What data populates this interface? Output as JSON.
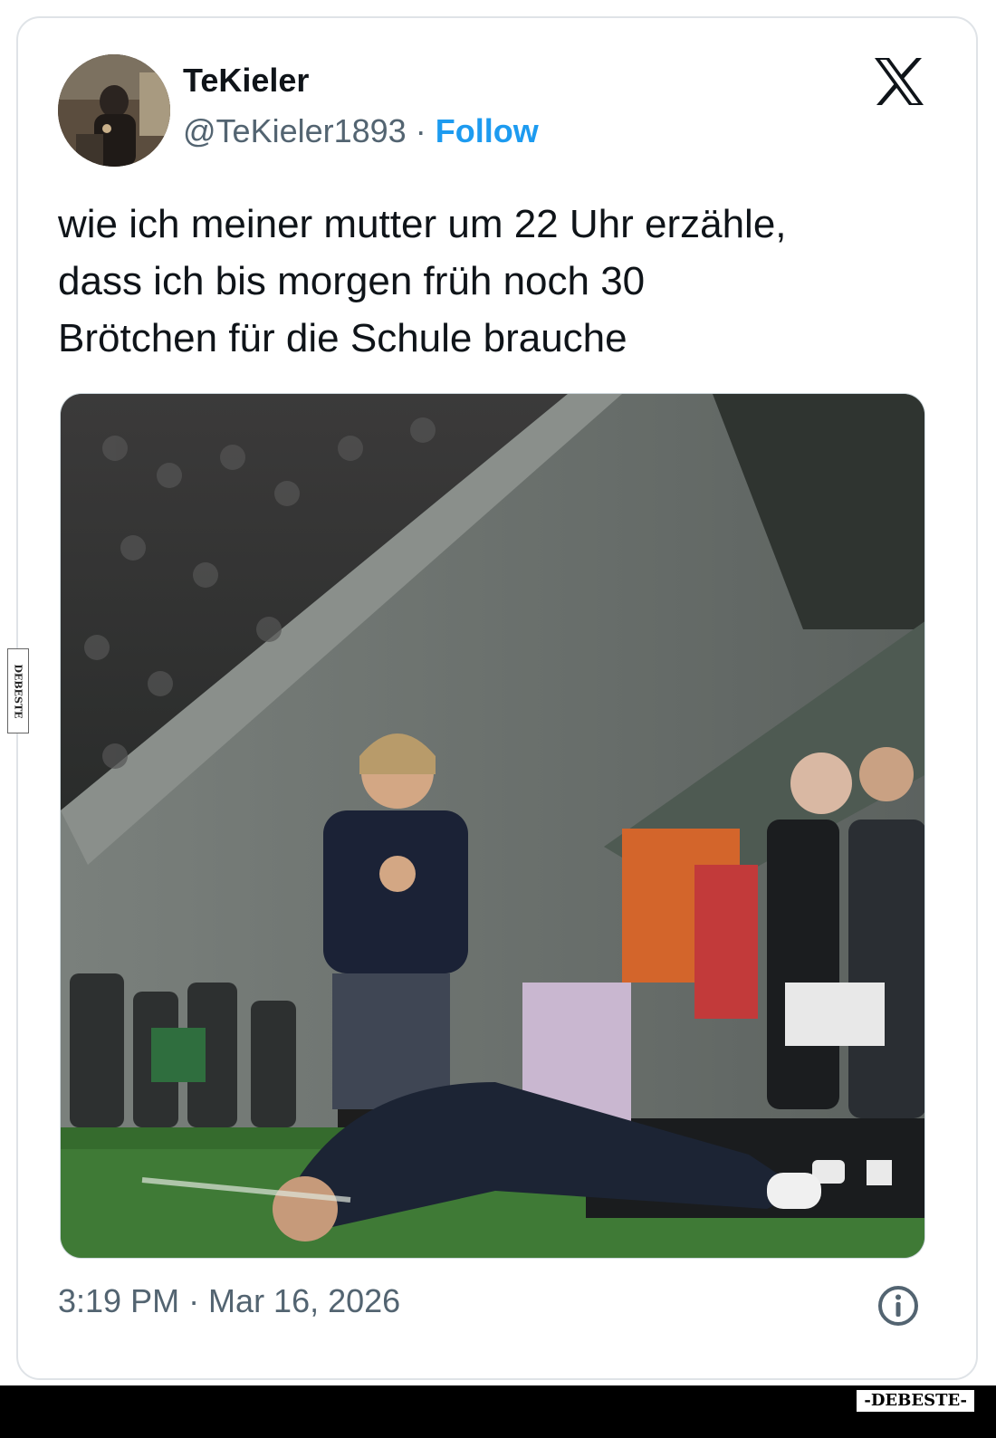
{
  "tweet": {
    "display_name": "TeKieler",
    "handle": "@TeKieler1893",
    "separator": "·",
    "follow_label": "Follow",
    "text_lines": [
      "wie ich meiner mutter um 22 Uhr erzähle,",
      "dass ich bis morgen früh noch 30",
      "Brötchen für die Schule brauche"
    ],
    "timestamp": "3:19 PM · Mar 16, 2026"
  },
  "icons": {
    "platform_logo": "x-logo-icon",
    "info": "info-icon"
  },
  "watermark": {
    "side_text": "DEBESTE",
    "footer_text": "-DEBESTE-"
  },
  "colors": {
    "text": "#0f1419",
    "muted": "#536471",
    "follow": "#1d9bf0",
    "border": "#dfe3e7",
    "pitch_green": "#3f7a36"
  }
}
